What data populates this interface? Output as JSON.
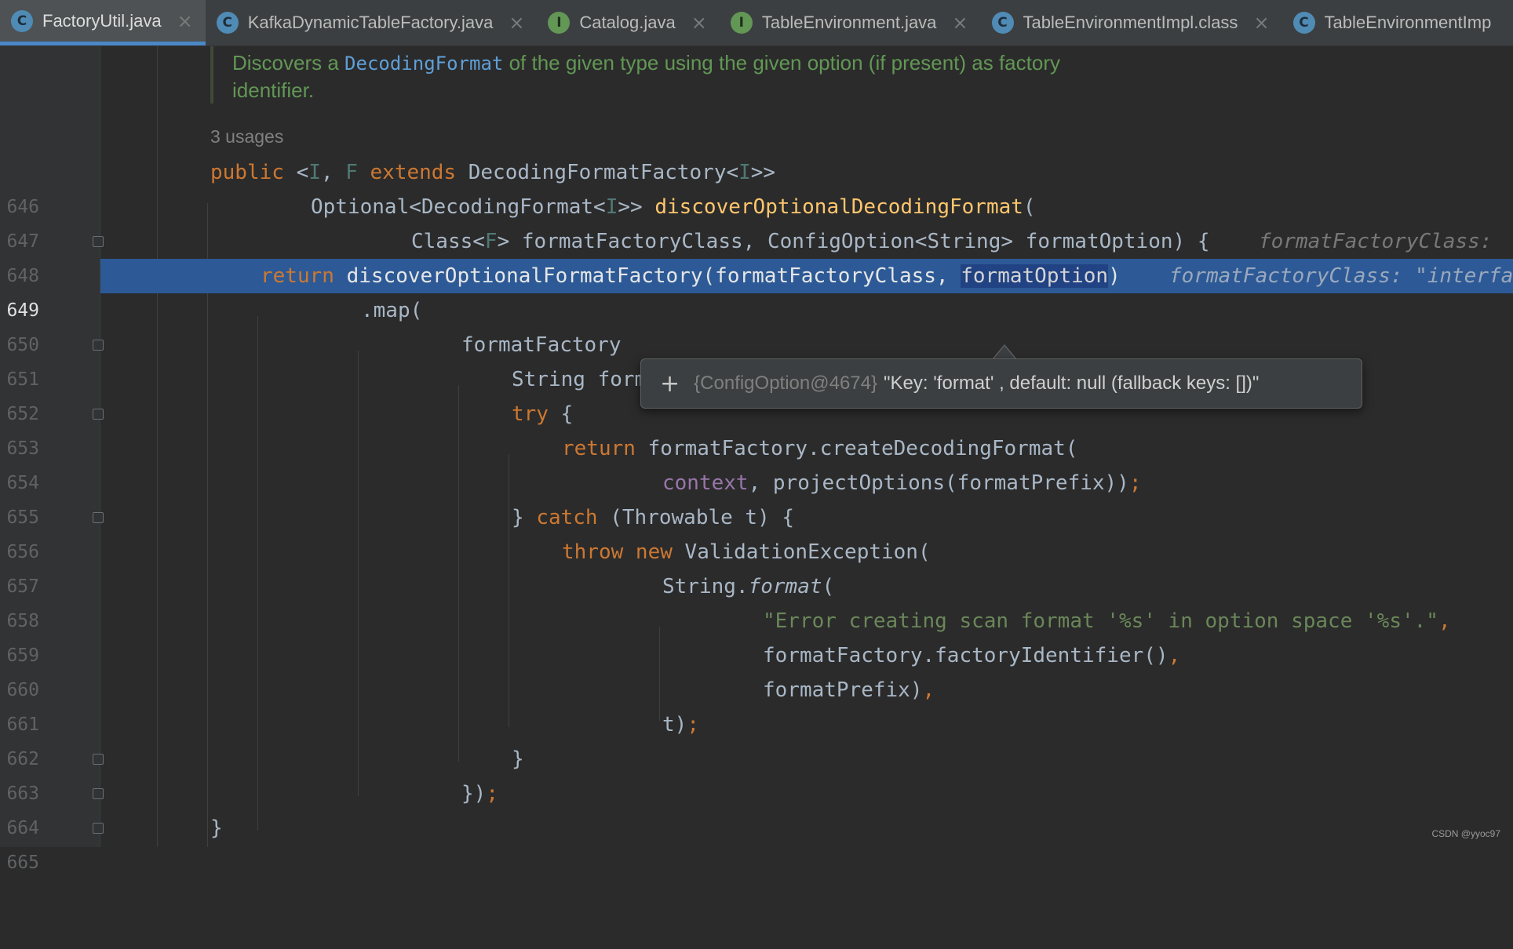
{
  "tabs": [
    {
      "label": "FactoryUtil.java",
      "kind": "C",
      "active": true
    },
    {
      "label": "KafkaDynamicTableFactory.java",
      "kind": "C"
    },
    {
      "label": "Catalog.java",
      "kind": "I"
    },
    {
      "label": "TableEnvironment.java",
      "kind": "I"
    },
    {
      "label": "TableEnvironmentImpl.class",
      "kind": "C"
    },
    {
      "label": "TableEnvironmentImp",
      "kind": "C"
    }
  ],
  "doc": {
    "line1_pre": "Discovers a ",
    "line1_link": "DecodingFormat",
    "line1_post": " of the given type using the given option (if present) as factory",
    "line2": "identifier."
  },
  "usages": "3 usages",
  "line_numbers": [
    "646",
    "647",
    "648",
    "649",
    "650",
    "651",
    "652",
    "653",
    "654",
    "655",
    "656",
    "657",
    "658",
    "659",
    "660",
    "661",
    "662",
    "663",
    "664",
    "665"
  ],
  "code": {
    "l646": {
      "kw": "public",
      "a": " <",
      "t1": "I",
      "b": ", ",
      "t2": "F",
      "kw2": " extends",
      "c": " DecodingFormatFactory<",
      "t3": "I",
      "d": ">>"
    },
    "l647": {
      "a": "Optional<DecodingFormat<",
      "t": "I",
      "b": ">> ",
      "fn": "discoverOptionalDecodingFormat",
      "c": "("
    },
    "l648": {
      "a": "Class<",
      "t": "F",
      "b": "> formatFactoryClass, ConfigOption<String> formatOption) {",
      "hint": "formatFactoryClass: "
    },
    "l649": {
      "kw": "return",
      "a": " discoverOptionalFormatFactory(formatFactoryClass, ",
      "sel": "formatOption",
      "b": ")",
      "hint": "formatFactoryClass: \"interfa"
    },
    "l650": {
      "a": ".map("
    },
    "l651": {
      "a": "formatFactory"
    },
    "l652": {
      "a": "String formatPrefix = formatPrefix(formatFactory, ",
      "u": "formatOption",
      "b": ")",
      "semi": ";"
    },
    "l653": {
      "kw": "try",
      "a": " {"
    },
    "l654": {
      "kw": "return",
      "a": " formatFactory.createDecodingFormat("
    },
    "l655": {
      "f": "context",
      "a": ", projectOptions(formatPrefix))",
      "semi": ";"
    },
    "l656": {
      "a": "} ",
      "kw": "catch",
      "b": " (Throwable t) {"
    },
    "l657": {
      "kw": "throw new",
      "a": " ValidationException("
    },
    "l658": {
      "a": "String.",
      "it": "format",
      "b": "("
    },
    "l659": {
      "str": "\"Error creating scan format '%s' in option space '%s'.\"",
      "a": ","
    },
    "l660": {
      "a": "formatFactory.factoryIdentifier()",
      "semi": ","
    },
    "l661": {
      "a": "formatPrefix)",
      "semi": ","
    },
    "l662": {
      "a": "t)",
      "semi": ";"
    },
    "l663": {
      "a": "}"
    },
    "l664": {
      "a": "})",
      "semi": ";"
    },
    "l665": {
      "a": "}"
    }
  },
  "tooltip": {
    "plus": "+",
    "object": "{ConfigOption@4674}",
    "value": "\"Key: 'format' , default: null (fallback keys: [])\""
  },
  "watermark": "CSDN @yyoc97",
  "colors": {
    "accent": "#4a88c7",
    "current_line": "#2d5a96",
    "keyword": "#cc7832",
    "function": "#ffc66d",
    "string": "#6a8759",
    "comment": "#629755"
  }
}
